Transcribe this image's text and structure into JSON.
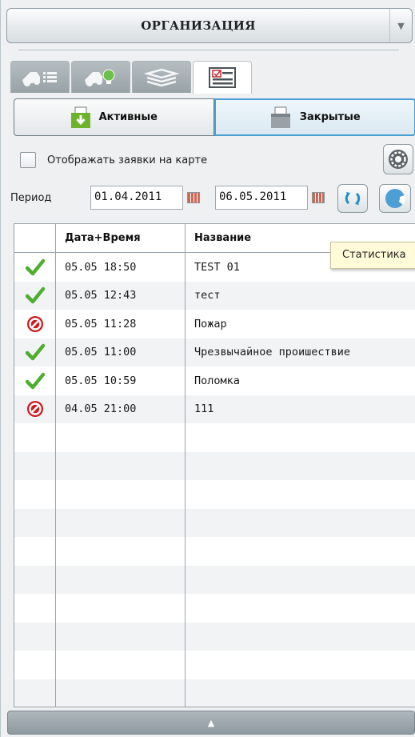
{
  "header": {
    "title": "ОРГАНИЗАЦИЯ",
    "dropdown_icon": "chevron-down-icon"
  },
  "tabs": [
    {
      "name": "truck-list",
      "icon": "truck-list-icon",
      "active": false
    },
    {
      "name": "truck-bulb",
      "icon": "truck-bulb-icon",
      "active": false
    },
    {
      "name": "layers",
      "icon": "layers-icon",
      "active": false
    },
    {
      "name": "requests",
      "icon": "checklist-icon",
      "active": true
    }
  ],
  "subtabs": {
    "active_label": "Активные",
    "closed_label": "Закрытые"
  },
  "filters": {
    "show_on_map_label": "Отображать заявки на карте",
    "show_on_map_checked": false
  },
  "period": {
    "label": "Период",
    "from": "01.04.2011",
    "to": "06.05.2011"
  },
  "tooltip": {
    "text": "Статистика"
  },
  "table": {
    "columns": {
      "time": "Дата+Время",
      "name": "Название"
    },
    "rows": [
      {
        "status": "ok",
        "time": "05.05 18:50",
        "name": "TEST 01"
      },
      {
        "status": "ok",
        "time": "05.05 12:43",
        "name": "тест"
      },
      {
        "status": "rejected",
        "time": "05.05 11:28",
        "name": "Пожар"
      },
      {
        "status": "ok",
        "time": "05.05 11:00",
        "name": "Чрезвычайное проишествие"
      },
      {
        "status": "ok",
        "time": "05.05 10:59",
        "name": "Поломка"
      },
      {
        "status": "rejected",
        "time": "04.05 21:00",
        "name": "111"
      },
      {
        "status": "",
        "time": "",
        "name": ""
      },
      {
        "status": "",
        "time": "",
        "name": ""
      },
      {
        "status": "",
        "time": "",
        "name": ""
      },
      {
        "status": "",
        "time": "",
        "name": ""
      },
      {
        "status": "",
        "time": "",
        "name": ""
      },
      {
        "status": "",
        "time": "",
        "name": ""
      },
      {
        "status": "",
        "time": "",
        "name": ""
      },
      {
        "status": "",
        "time": "",
        "name": ""
      },
      {
        "status": "",
        "time": "",
        "name": ""
      },
      {
        "status": "",
        "time": "",
        "name": ""
      }
    ]
  },
  "colors": {
    "accent": "#4a9fd2",
    "ok": "#4fae2f",
    "rejected": "#d0181c"
  },
  "footer": {
    "icon": "chevron-up-icon"
  }
}
